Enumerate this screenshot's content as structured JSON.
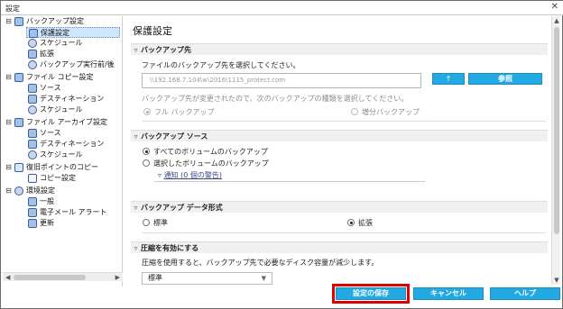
{
  "window": {
    "title": "設定",
    "close_glyph": "✕"
  },
  "tree": [
    {
      "label": "バックアップ設定",
      "toggle": "⊟"
    },
    {
      "label": "保護設定"
    },
    {
      "label": "スケジュール"
    },
    {
      "label": "拡張"
    },
    {
      "label": "バックアップ実行前/後"
    },
    {
      "label": "ファイル コピー設定",
      "toggle": "⊟"
    },
    {
      "label": "ソース"
    },
    {
      "label": "デスティネーション"
    },
    {
      "label": "スケジュール"
    },
    {
      "label": "ファイル アーカイブ設定",
      "toggle": "⊟"
    },
    {
      "label": "ソース"
    },
    {
      "label": "デスティネーション"
    },
    {
      "label": "スケジュール"
    },
    {
      "label": "復旧ポイントのコピー",
      "toggle": "⊟"
    },
    {
      "label": "コピー設定"
    },
    {
      "label": "環境設定",
      "toggle": "⊟"
    },
    {
      "label": "一般"
    },
    {
      "label": "電子メール アラート"
    },
    {
      "label": "更新"
    }
  ],
  "main": {
    "page_title": "保護設定",
    "dest_section": {
      "header": "バックアップ先",
      "prompt": "ファイルのバックアップ先を選択してください。",
      "path_value": "\\\\192.168.7.104\\w\\2016\\1115_protect.com",
      "up_button": "↑",
      "browse_button": "参照",
      "notice": "バックアップ先が変更されたので、次のバックアップの種類を選択してください。",
      "full_backup": "フル バックアップ",
      "incr_backup": "増分バックアップ"
    },
    "source_section": {
      "header": "バックアップ ソース",
      "all_volumes": "すべてのボリュームのバックアップ",
      "selected_volumes": "選択したボリュームのバックアップ",
      "notify": "通知 (0 個の警告)"
    },
    "format_section": {
      "header": "バックアップ データ形式",
      "standard": "標準",
      "extended": "拡張"
    },
    "compress_section": {
      "header": "圧縮を有効にする",
      "desc": "圧縮を使用すると、バックアップ先で必要なディスク容量が減少します。",
      "selected": "標準"
    }
  },
  "buttons": {
    "save": "設定の保存",
    "cancel": "キャンセル",
    "help": "ヘルプ"
  }
}
